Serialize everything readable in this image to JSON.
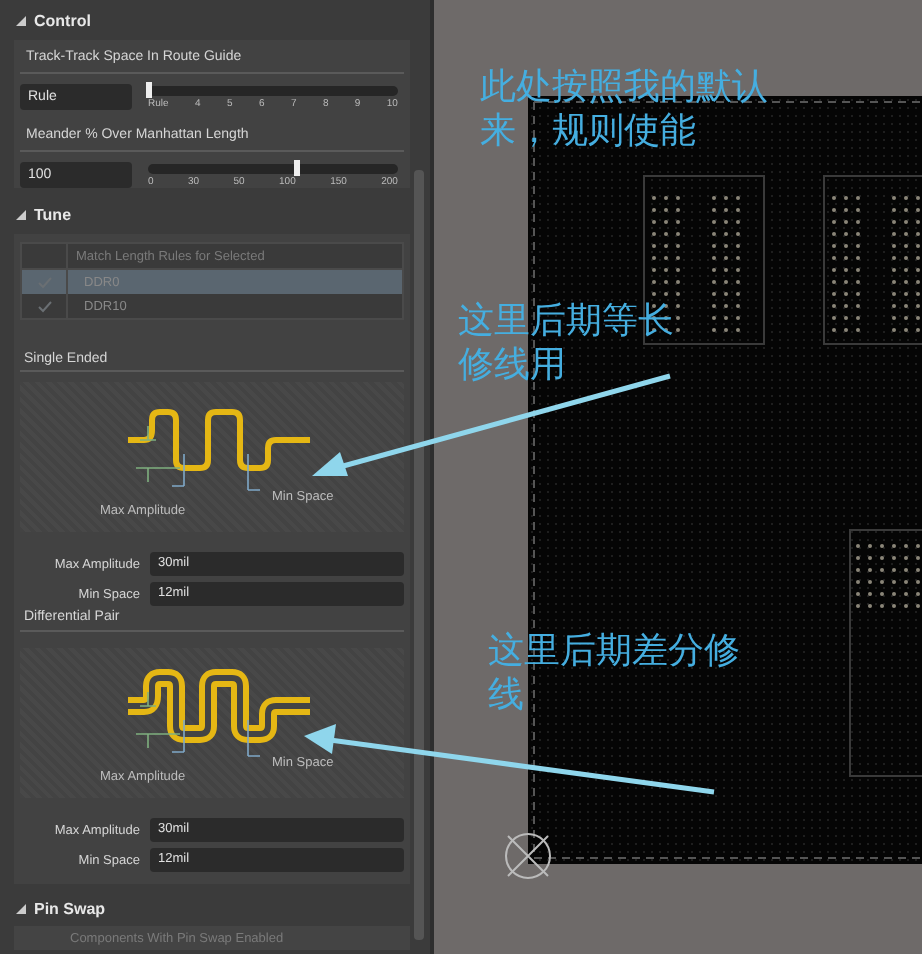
{
  "control": {
    "title": "Control",
    "expanded": true,
    "sliders": [
      {
        "label": "Track-Track Space In Route Guide",
        "value": "Rule",
        "level": 0,
        "ticks": [
          "Rule",
          "4",
          "5",
          "6",
          "7",
          "8",
          "9",
          "10"
        ]
      },
      {
        "label": "Meander % Over Manhattan Length",
        "value": "100",
        "level": 0.59,
        "ticks": [
          "0",
          "30",
          "50",
          "100",
          "150",
          "200"
        ]
      }
    ]
  },
  "tune": {
    "title": "Tune",
    "expanded": true,
    "rules_table": {
      "header": "Match Length Rules for Selected",
      "rows": [
        {
          "name": "DDR0",
          "checked": true,
          "selected": true
        },
        {
          "name": "DDR10",
          "checked": true,
          "selected": false
        }
      ]
    },
    "styles": [
      {
        "title": "Single Ended",
        "kind": "single",
        "diagram_labels": [
          "Max Amplitude",
          "Min Space"
        ],
        "fields": [
          {
            "label": "Max Amplitude",
            "value": "30mil"
          },
          {
            "label": "Min Space",
            "value": "12mil"
          }
        ]
      },
      {
        "title": "Differential Pair",
        "kind": "differential",
        "diagram_labels": [
          "Max Amplitude",
          "Min Space"
        ],
        "fields": [
          {
            "label": "Max Amplitude",
            "value": "30mil"
          },
          {
            "label": "Min Space",
            "value": "12mil"
          }
        ]
      }
    ]
  },
  "pin_swap": {
    "title": "Pin Swap",
    "expanded": true,
    "table_header": "Components With Pin Swap Enabled"
  },
  "annotations": [
    {
      "text": "此处按照我的默认来，规则使能"
    },
    {
      "text": "这里后期等长修线用"
    },
    {
      "text": "这里后期差分修线"
    }
  ]
}
